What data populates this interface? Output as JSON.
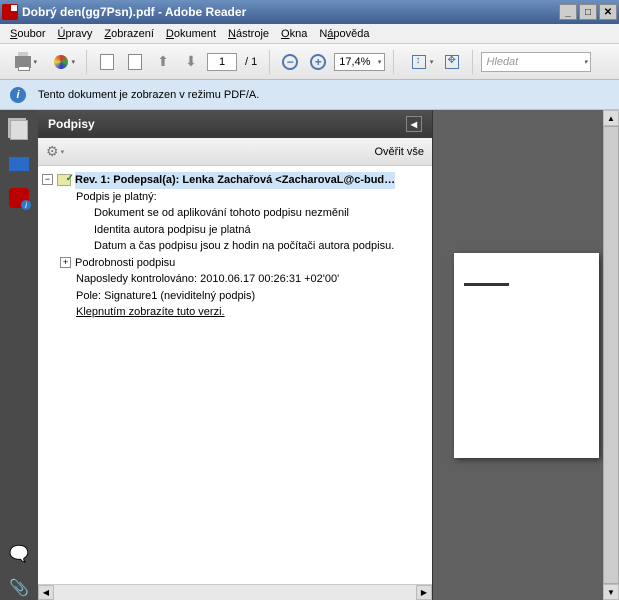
{
  "window": {
    "title": "Dobrý den(gg7Psn).pdf - Adobe Reader"
  },
  "menu": {
    "items": [
      {
        "label": "Soubor",
        "u": "S"
      },
      {
        "label": "Úpravy",
        "u": "Ú"
      },
      {
        "label": "Zobrazení",
        "u": "Z"
      },
      {
        "label": "Dokument",
        "u": "D"
      },
      {
        "label": "Nástroje",
        "u": "N"
      },
      {
        "label": "Okna",
        "u": "O"
      },
      {
        "label": "Nápověda",
        "u": "á"
      }
    ]
  },
  "toolbar": {
    "page_current": "1",
    "page_total": "/ 1",
    "zoom": "17,4%",
    "search_placeholder": "Hledat"
  },
  "infobar": {
    "text": "Tento dokument je zobrazen v režimu PDF/A."
  },
  "signatures": {
    "panel_title": "Podpisy",
    "verify_all": "Ověřit vše",
    "rev_label": "Rev. 1: Podepsal(a): Lenka Zachařová <ZacharovaL@c-bud…",
    "valid": "Podpis je platný:",
    "doc_unchanged": "Dokument se od aplikování tohoto podpisu nezměnil",
    "identity_valid": "Identita autora podpisu je platná",
    "time_local": "Datum a čas podpisu jsou z hodin na počítači autora podpisu.",
    "details": "Podrobnosti podpisu",
    "last_checked": "Naposledy kontrolováno: 2010.06.17 00:26:31 +02'00'",
    "field": "Pole: Signature1 (neviditelný podpis)",
    "click_version": "Klepnutím zobrazíte tuto verzi."
  }
}
